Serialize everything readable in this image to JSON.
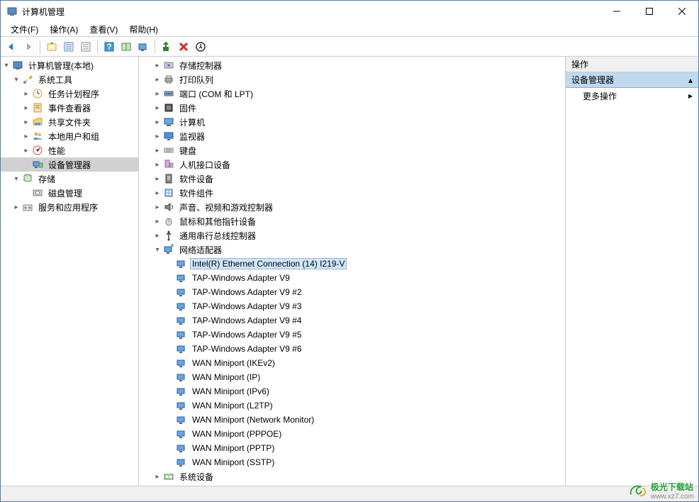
{
  "window": {
    "title": "计算机管理"
  },
  "menu": {
    "items": [
      "文件(F)",
      "操作(A)",
      "查看(V)",
      "帮助(H)"
    ]
  },
  "left_tree": {
    "root": "计算机管理(本地)",
    "system_tools": "系统工具",
    "task_scheduler": "任务计划程序",
    "event_viewer": "事件查看器",
    "shared_folders": "共享文件夹",
    "local_users": "本地用户和组",
    "performance": "性能",
    "device_manager": "设备管理器",
    "storage": "存储",
    "disk_mgmt": "磁盘管理",
    "services_apps": "服务和应用程序"
  },
  "center_tree": {
    "storage_ctrl": "存储控制器",
    "print_queue": "打印队列",
    "ports": "端口 (COM 和 LPT)",
    "firmware": "固件",
    "computer": "计算机",
    "monitor": "监视器",
    "keyboard": "键盘",
    "hid": "人机接口设备",
    "soft_devices": "软件设备",
    "soft_components": "软件组件",
    "audio": "声音、视频和游戏控制器",
    "mouse": "鼠标和其他指针设备",
    "usb": "通用串行总线控制器",
    "network": "网络适配器",
    "adapters": [
      "Intel(R) Ethernet Connection (14) I219-V",
      "TAP-Windows Adapter V9",
      "TAP-Windows Adapter V9 #2",
      "TAP-Windows Adapter V9 #3",
      "TAP-Windows Adapter V9 #4",
      "TAP-Windows Adapter V9 #5",
      "TAP-Windows Adapter V9 #6",
      "WAN Miniport (IKEv2)",
      "WAN Miniport (IP)",
      "WAN Miniport (IPv6)",
      "WAN Miniport (L2TP)",
      "WAN Miniport (Network Monitor)",
      "WAN Miniport (PPPOE)",
      "WAN Miniport (PPTP)",
      "WAN Miniport (SSTP)"
    ],
    "sys_devices": "系统设备"
  },
  "right_panel": {
    "header": "操作",
    "section": "设备管理器",
    "more": "更多操作"
  },
  "status": "",
  "watermark": {
    "name": "极光下载站",
    "url": "www.xz7.com"
  }
}
